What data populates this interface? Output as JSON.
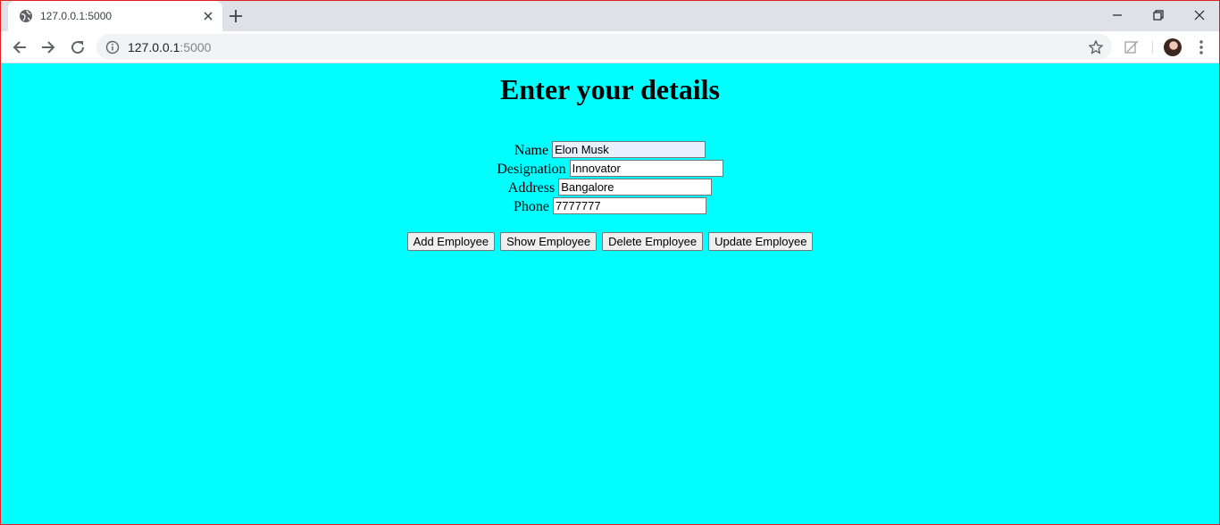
{
  "browser": {
    "tab_title": "127.0.0.1:5000",
    "url_host": "127.0.0.1",
    "url_port": ":5000"
  },
  "page": {
    "heading": "Enter your details",
    "fields": [
      {
        "label": "Name",
        "value": "Elon Musk"
      },
      {
        "label": "Designation",
        "value": "Innovator"
      },
      {
        "label": "Address",
        "value": "Bangalore"
      },
      {
        "label": "Phone",
        "value": "7777777"
      }
    ],
    "buttons": {
      "add": "Add Employee",
      "show": "Show Employee",
      "delete": "Delete Employee",
      "update": "Update Employee"
    }
  },
  "icons": {
    "favicon": "globe-icon",
    "tab_close": "close-icon",
    "new_tab": "plus-icon",
    "back": "arrow-left-icon",
    "forward": "arrow-right-icon",
    "reload": "reload-icon",
    "site_info": "info-icon",
    "bookmark": "star-icon",
    "extension": "edit-off-icon",
    "menu": "kebab-menu-icon"
  },
  "colors": {
    "page_background": "#00ffff",
    "tab_strip": "#dee1e6",
    "window_border": "#e02020"
  }
}
